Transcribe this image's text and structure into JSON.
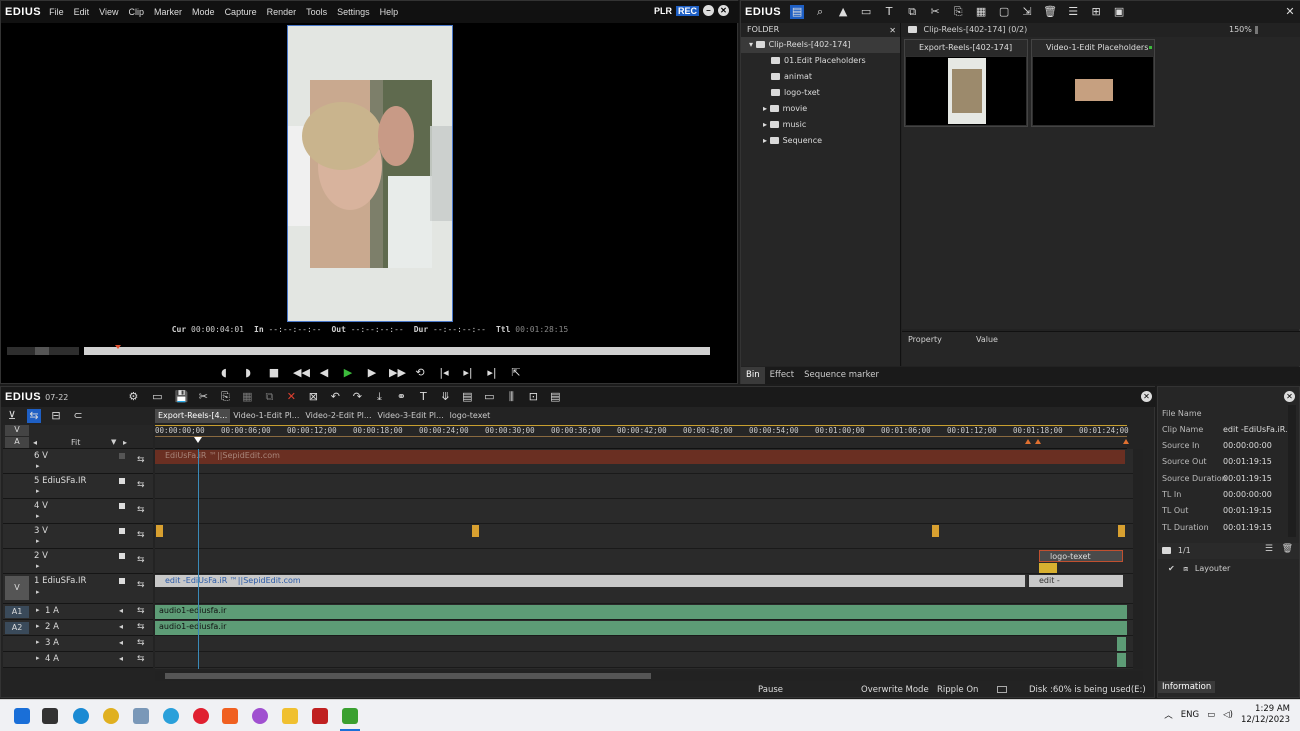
{
  "app": {
    "logo": "EDIUS"
  },
  "menu": [
    "File",
    "Edit",
    "View",
    "Clip",
    "Marker",
    "Mode",
    "Capture",
    "Render",
    "Tools",
    "Settings",
    "Help"
  ],
  "player": {
    "mode_plr": "PLR",
    "mode_rec": "REC",
    "cur_label": "Cur",
    "cur_value": "00:00:04:01",
    "in_label": "In",
    "in_value": "--:--:--:--",
    "out_label": "Out",
    "out_value": "--:--:--:--",
    "dur_label": "Dur",
    "dur_value": "--:--:--:--",
    "ttl_label": "Ttl",
    "ttl_value": "00:01:28:15"
  },
  "bin": {
    "logo": "EDIUS",
    "folder_header": "FOLDER",
    "tree": [
      {
        "label": "Clip-Reels-[402-174]",
        "level": 0,
        "expanded": true,
        "selected": true
      },
      {
        "label": "01.Edit Placeholders",
        "level": 1
      },
      {
        "label": "animat",
        "level": 1
      },
      {
        "label": "logo-txet",
        "level": 1
      },
      {
        "label": "movie",
        "level": 1,
        "collapsed": true
      },
      {
        "label": "music",
        "level": 1,
        "collapsed": true
      },
      {
        "label": "Sequence",
        "level": 1,
        "collapsed": true
      }
    ],
    "path": "Clip-Reels-[402-174] (0/2)",
    "zoom": "150%",
    "clips": [
      {
        "label": "Export-Reels-[402-174]"
      },
      {
        "label": "Video-1-Edit Placeholders"
      }
    ],
    "property_header": "Property",
    "value_header": "Value",
    "tabs": [
      "Bin",
      "Effect",
      "Sequence marker"
    ]
  },
  "timeline": {
    "logo": "EDIUS",
    "project": "07-22",
    "fit_label": "Fit",
    "sequence_tabs": [
      "Export-Reels-[4...",
      "Video-1-Edit Pl...",
      "Video-2-Edit Pl...",
      "Video-3-Edit Pl...",
      "logo-texet"
    ],
    "ruler": [
      "00:00:00;00",
      "00:00:06;00",
      "00:00:12;00",
      "00:00:18;00",
      "00:00:24;00",
      "00:00:30;00",
      "00:00:36;00",
      "00:00:42;00",
      "00:00:48;00",
      "00:00:54;00",
      "00:01:00;00",
      "00:01:06;00",
      "00:01:12;00",
      "00:01:18;00",
      "00:01:24;00"
    ],
    "patch_v": "V",
    "patch_a": "A",
    "tracks": [
      {
        "name": "6 V",
        "patch": ""
      },
      {
        "name": "5 EdiuSFa.IR",
        "patch": ""
      },
      {
        "name": "4 V",
        "patch": ""
      },
      {
        "name": "3 V",
        "patch": ""
      },
      {
        "name": "2 V",
        "patch": ""
      },
      {
        "name": "1 EdiuSFa.IR",
        "patch": "V"
      },
      {
        "name": "1 A",
        "patch": "A1"
      },
      {
        "name": "2 A",
        "patch": "A2"
      },
      {
        "name": "3 A",
        "patch": ""
      },
      {
        "name": "4 A",
        "patch": ""
      }
    ],
    "clips": {
      "v6": "EdiUsFa.iR ™||SepidEdit.com",
      "v2": "logo-texet",
      "v1a": "edit -EdiUsFa.iR ™||SepidEdit.com",
      "v1b": "edit -",
      "a1": "audio1-ediusfa.ir",
      "a2": "audio1-ediusfa.ir"
    },
    "status": {
      "pause": "Pause",
      "overwrite": "Overwrite Mode",
      "ripple": "Ripple On",
      "disk": "Disk :60% is being used(E:)"
    }
  },
  "info": {
    "rows": [
      {
        "k": "File Name",
        "v": ""
      },
      {
        "k": "Clip Name",
        "v": "edit -EdiUsFa.iR..."
      },
      {
        "k": "Source In",
        "v": "00:00:00:00"
      },
      {
        "k": "Source Out",
        "v": "00:01:19:15"
      },
      {
        "k": "Source Duration",
        "v": "00:01:19:15"
      },
      {
        "k": "TL In",
        "v": "00:00:00:00"
      },
      {
        "k": "TL Out",
        "v": "00:01:19:15"
      },
      {
        "k": "TL Duration",
        "v": "00:01:19:15"
      }
    ],
    "page": "1/1",
    "layer": "Layouter",
    "tab": "Information"
  },
  "taskbar": {
    "lang": "ENG",
    "time": "1:29 AM",
    "date": "12/12/2023"
  }
}
